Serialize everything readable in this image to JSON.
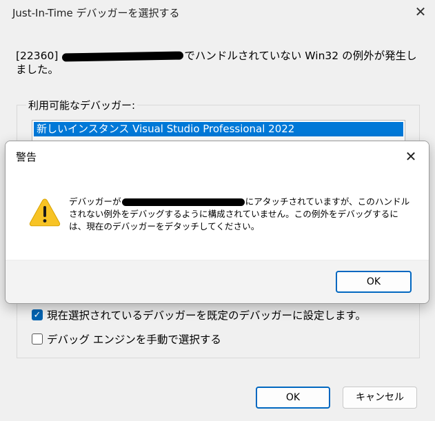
{
  "background_dialog": {
    "title": "Just-In-Time デバッガーを選択する",
    "close_symbol": "✕",
    "message_prefix": "[22360]",
    "message_suffix": "でハンドルされていない Win32 の例外が発生しました。",
    "available_debuggers_label": "利用可能なデバッガー:",
    "debugger_items": [
      "新しいインスタンス Visual Studio Professional 2022"
    ],
    "checkbox_default": {
      "label": "現在選択されているデバッガーを既定のデバッガーに設定します。",
      "checked": true
    },
    "checkbox_manual": {
      "label": "デバッグ エンジンを手動で選択する",
      "checked": false
    },
    "ok_label": "OK",
    "cancel_label": "キャンセル"
  },
  "warning_dialog": {
    "title": "警告",
    "close_symbol": "✕",
    "icon": "warning-icon",
    "message_prefix": "デバッガーが",
    "message_rest": "にアタッチされていますが、このハンドルされない例外をデバッグするように構成されていません。この例外をデバッグするには、現在のデバッガーをデタッチしてください。",
    "ok_label": "OK"
  },
  "colors": {
    "accent": "#0078d7",
    "checkbox": "#0063b1",
    "warning_yellow": "#f7c325"
  }
}
